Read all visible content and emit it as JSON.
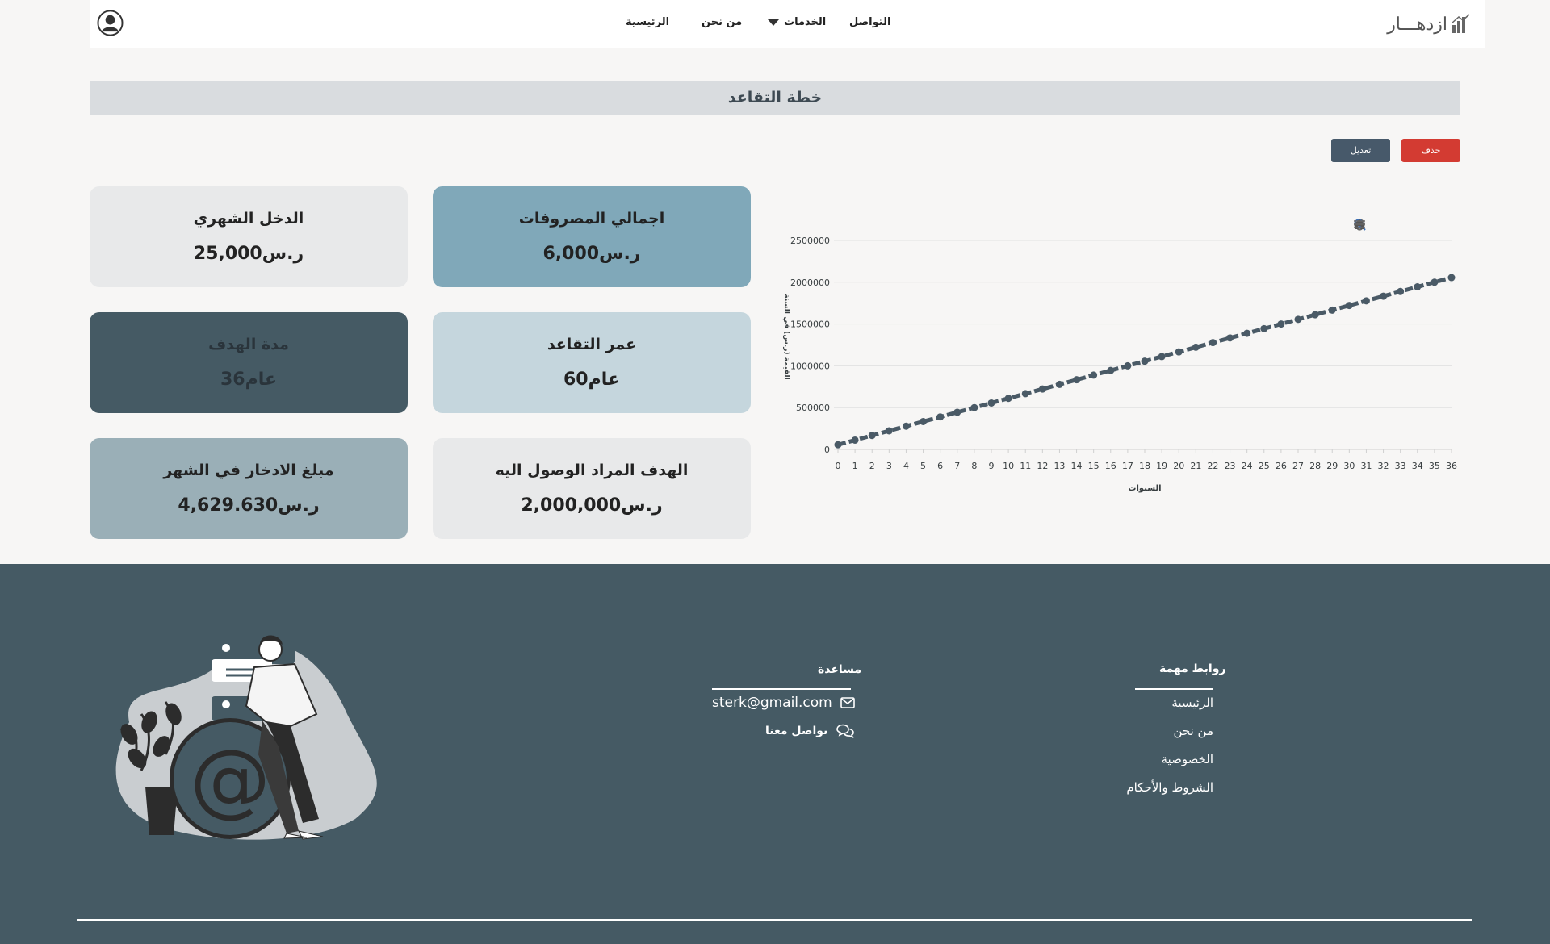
{
  "nav": {
    "home": "الرئيسية",
    "about": "من نحن",
    "services": "الخدمات",
    "contact": "التواصل",
    "logo_text": "ازدهـــار"
  },
  "page": {
    "title": "خطة التقاعد"
  },
  "actions": {
    "delete_label": "حذف",
    "edit_label": "تعديل"
  },
  "cards": {
    "monthly_income": {
      "label": "الدخل الشهري",
      "value": "25,000ر.س"
    },
    "total_expenses": {
      "label": "اجمالي المصروفات",
      "value": "6,000ر.س"
    },
    "target_duration": {
      "label": "مدة الهدف",
      "value": "36عام"
    },
    "retirement_age": {
      "label": "عمر التقاعد",
      "value": "60عام"
    },
    "monthly_saving": {
      "label": "مبلغ الادخار في الشهر",
      "value": "4,629.630ر.س"
    },
    "target_goal": {
      "label": "الهدف المراد الوصول اليه",
      "value": "2,000,000ر.س"
    }
  },
  "chart_data": {
    "type": "line",
    "xlabel": "السنوات",
    "ylabel": "القيمة (ر.س) في السنة",
    "x": [
      0,
      1,
      2,
      3,
      4,
      5,
      6,
      7,
      8,
      9,
      10,
      11,
      12,
      13,
      14,
      15,
      16,
      17,
      18,
      19,
      20,
      21,
      22,
      23,
      24,
      25,
      26,
      27,
      28,
      29,
      30,
      31,
      32,
      33,
      34,
      35,
      36
    ],
    "yticks": [
      0,
      500000,
      1000000,
      1500000,
      2000000,
      2500000
    ],
    "ylim": [
      0,
      2500000
    ],
    "series": [
      {
        "values": [
          55556,
          111111,
          166667,
          222222,
          277778,
          333333,
          388889,
          444444,
          500000,
          555556,
          611111,
          666667,
          722222,
          777778,
          833333,
          888889,
          944444,
          1000000,
          1055556,
          1111111,
          1166667,
          1222222,
          1277778,
          1333333,
          1388889,
          1444444,
          1500000,
          1555556,
          1611111,
          1666667,
          1722222,
          1777778,
          1833333,
          1888889,
          1944444,
          2000000,
          2055556
        ],
        "color": "#4a5a66"
      }
    ],
    "grid": true,
    "legend": "none"
  },
  "footer": {
    "links_title": "روابط مهمة",
    "links": [
      "الرئيسية",
      "من نحن",
      "الخصوصية",
      "الشروط والأحكام"
    ],
    "help_title": "مساعدة",
    "email": "sterk@gmail.com",
    "contact_us": "تواصل معنا"
  },
  "colors": {
    "footer_bg": "#455a64",
    "card_dark": "#455a64",
    "card_steel": "#80a8b9",
    "card_light_blue": "#c5d6dd",
    "card_gray_blue": "#9aafb7",
    "card_light": "#e8e9ea",
    "delete": "#d33b32",
    "edit": "#47596a"
  }
}
